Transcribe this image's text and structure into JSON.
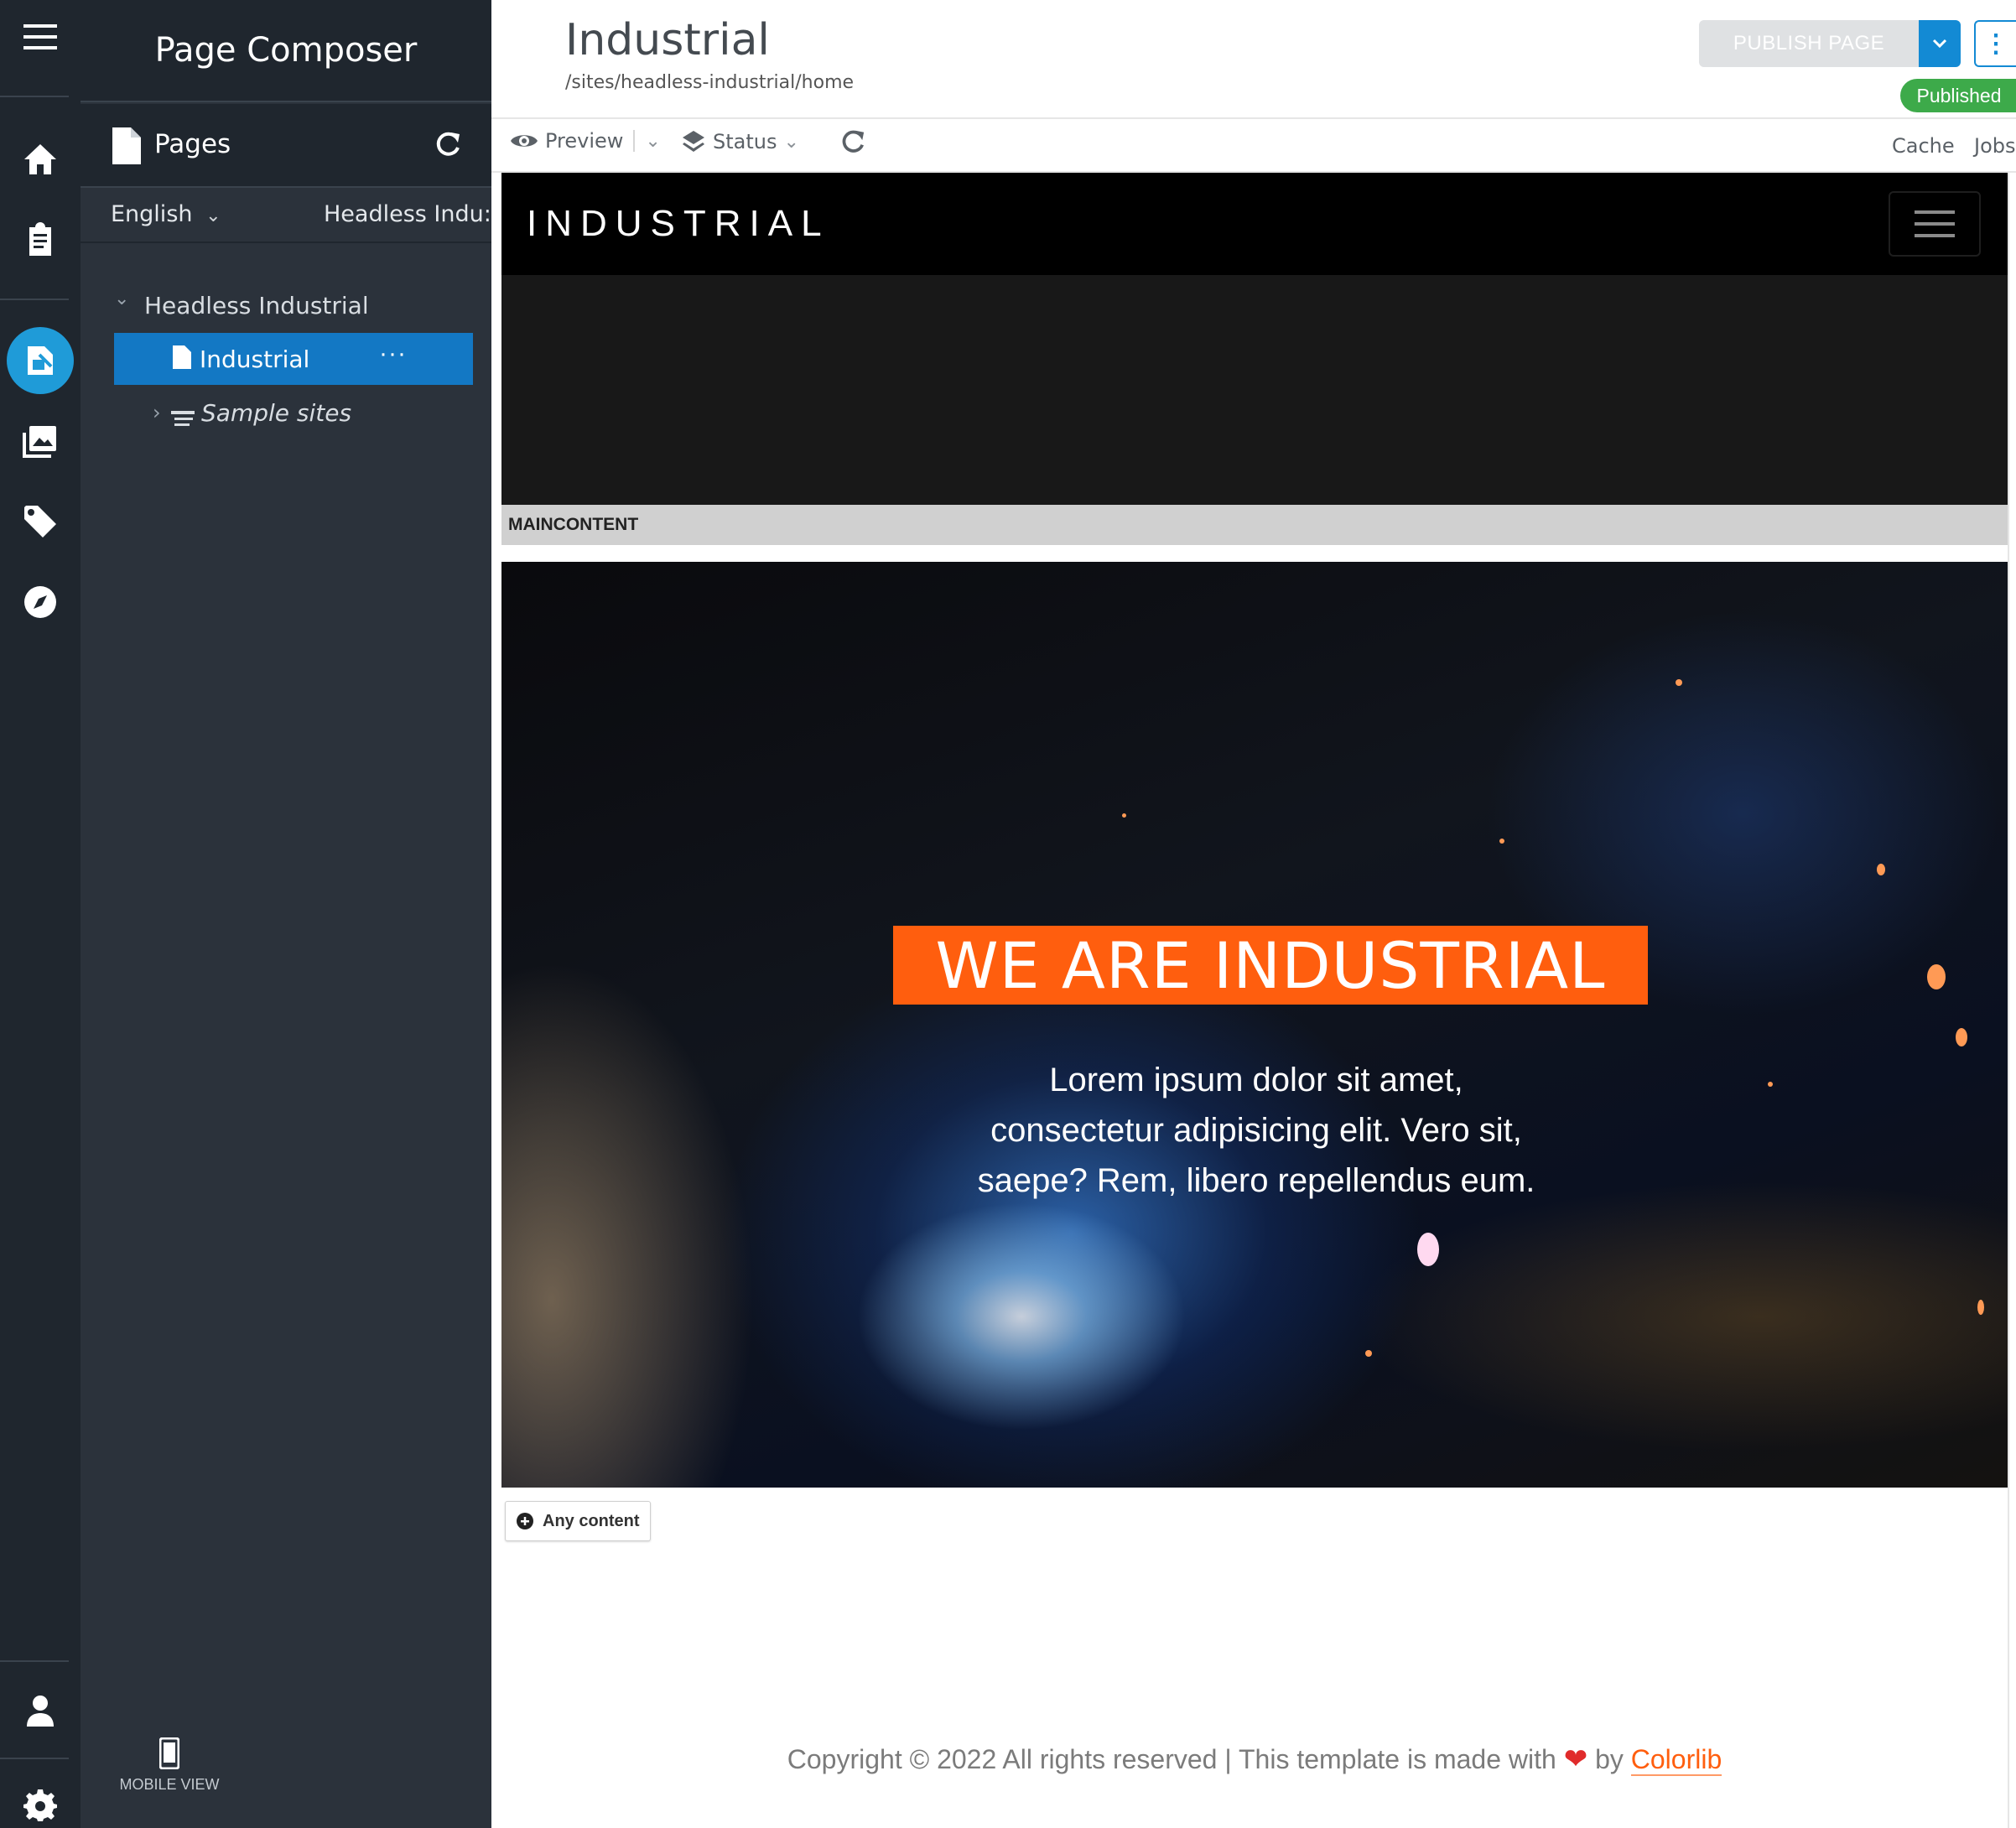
{
  "app": {
    "title": "Page Composer",
    "mobile_view_label": "MOBILE VIEW"
  },
  "pages_panel": {
    "label": "Pages",
    "language": "English",
    "site": "Headless Indu:",
    "tree": {
      "root": "Headless Industrial",
      "selected": "Industrial",
      "sample": "Sample sites"
    }
  },
  "header": {
    "title": "Industrial",
    "path": "/sites/headless-industrial/home",
    "publish_label": "PUBLISH PAGE",
    "status_badge": "Published"
  },
  "toolbar": {
    "preview_label": "Preview",
    "status_label": "Status",
    "cache_label": "Cache",
    "jobs_label": "Jobs"
  },
  "site": {
    "brand": "INDUSTRIAL",
    "area_label": "MAINCONTENT",
    "headline": "WE ARE INDUSTRIAL",
    "lead_lines": [
      "Lorem ipsum dolor sit amet,",
      "consectetur adipisicing elit. Vero sit,",
      "saepe? Rem, libero repellendus eum."
    ],
    "any_content_label": "Any content",
    "footer_text": "Copyright © 2022 All rights reserved | This template is made with",
    "footer_by": "by",
    "footer_brand": "Colorlib"
  },
  "colors": {
    "rail_bg": "#1f262e",
    "panel_bg": "#2b323b",
    "selected_bg": "#1378c4",
    "accent": "#138ad4",
    "status_green": "#3daa4a",
    "site_orange": "#ff5e0e"
  },
  "icons": {
    "rail": [
      "menu-icon",
      "home-icon",
      "clipboard-icon",
      "page-composer-icon",
      "media-icon",
      "tag-icon",
      "compass-icon",
      "user-icon",
      "settings-icon"
    ],
    "toolbar": [
      "eye-icon",
      "layers-icon",
      "refresh-icon"
    ]
  }
}
